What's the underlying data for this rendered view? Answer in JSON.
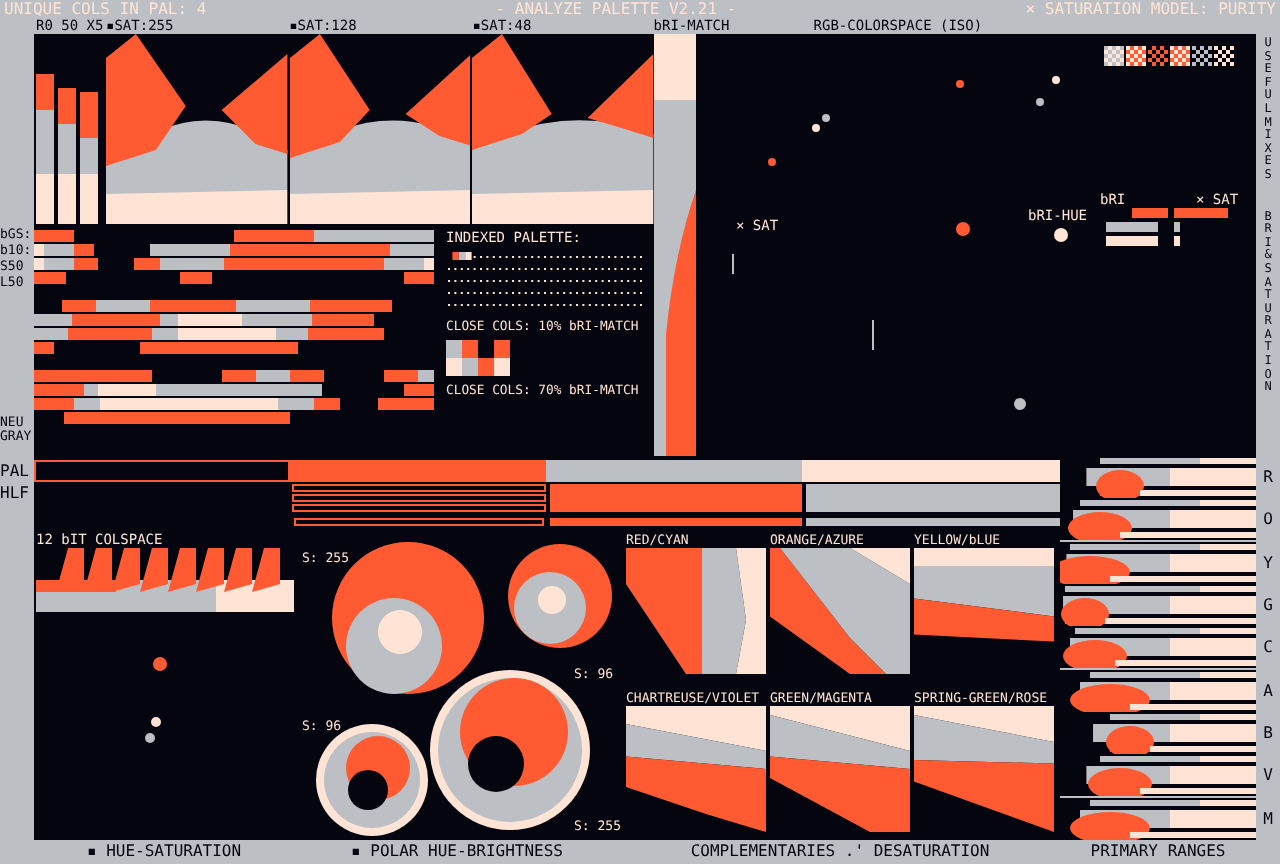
{
  "top_bar": {
    "unique": "UNIQUE COLS IN PAL: 4",
    "title": "- ANALYZE PALETTE V2.21 -",
    "model": "× SATURATION MODEL: PURITY"
  },
  "palette": {
    "colors": [
      {
        "color": "#05050f"
      },
      {
        "color": "#ff5a32"
      },
      {
        "color": "#bcc0c4"
      },
      {
        "color": "#ffe4d6"
      }
    ]
  },
  "hue_charts": {
    "side_label": "R0 50 X5",
    "charts": [
      {
        "label": "▪SAT:255"
      },
      {
        "label": "▪SAT:128"
      },
      {
        "label": "▪SAT:48"
      }
    ]
  },
  "bri_match": {
    "label": "bRI-MATCH"
  },
  "rgb_space": {
    "title": "RGB-COLORSPACE (ISO)",
    "sat_label": "× SAT",
    "bri_hue_label": "bRI-HUE",
    "bri_label": "bRI",
    "sat_label_2": "× SAT"
  },
  "bar_labels": [
    "bGS:",
    "b10:",
    "S50",
    "L50"
  ],
  "neutral_label": "NEU GRAY",
  "indexed_palette": {
    "title": "INDEXED PALETTE:",
    "close_10": "CLOSE COLS: 10% bRI-MATCH",
    "close_70": "CLOSE COLS: 70% bRI-MATCH"
  },
  "strip_labels": [
    "PAL",
    "HLF"
  ],
  "colspace": {
    "title": "12 bIT COLSPACE"
  },
  "polar": {
    "labels": [
      "S: 255",
      "S: 96",
      "S: 96",
      "S: 255"
    ]
  },
  "complementaries": [
    {
      "title": "RED/CYAN"
    },
    {
      "title": "ORANGE/AZURE"
    },
    {
      "title": "YELLOW/bLUE"
    },
    {
      "title": "CHARTREUSE/VIOLET"
    },
    {
      "title": "GREEN/MAGENTA"
    },
    {
      "title": "SPRING-GREEN/ROSE"
    }
  ],
  "side_titles": [
    "USEFUL MIXES",
    "BRI & SATURATION"
  ],
  "primary_ranges": [
    "R",
    "O",
    "Y",
    "G",
    "C",
    "A",
    "B",
    "V",
    "M"
  ],
  "footer": [
    "▪ HUE-SATURATION",
    "▪ POLAR HUE-BRIGHTNESS",
    "COMPLEMENTARIES .' DESATURATION",
    "PRIMARY RANGES"
  ]
}
